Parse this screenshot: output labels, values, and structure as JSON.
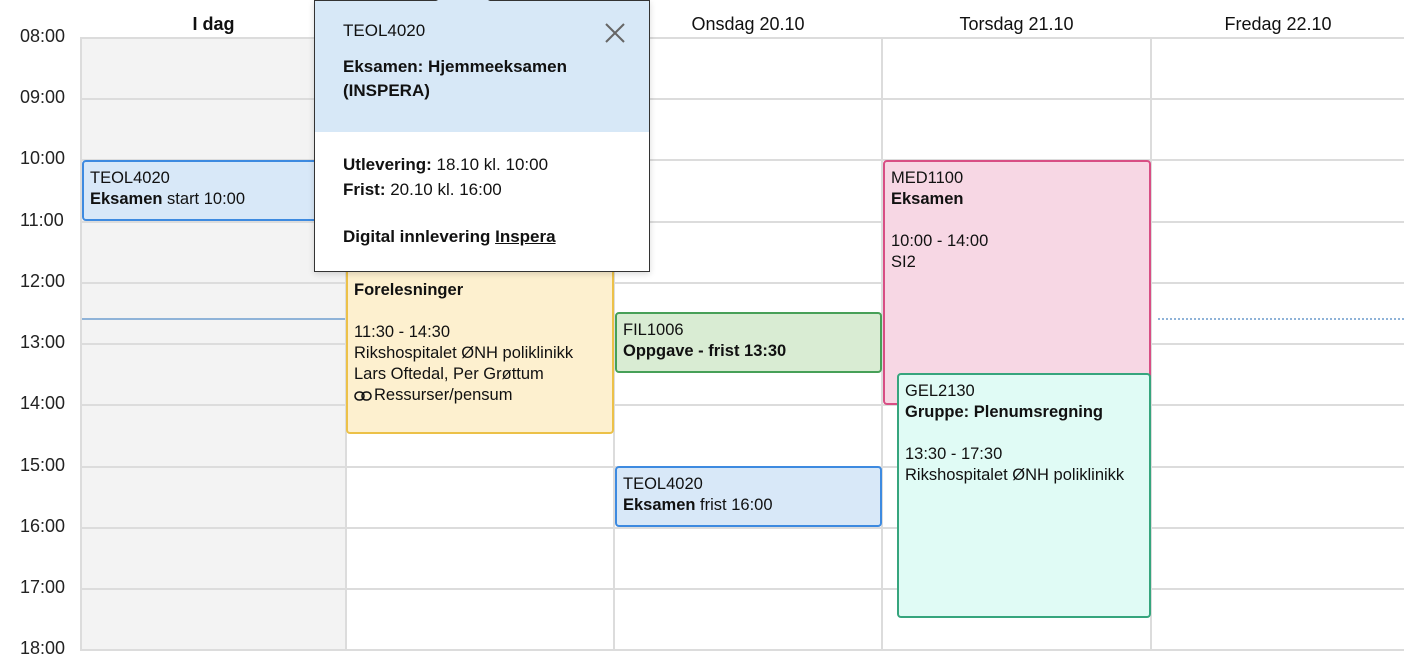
{
  "days": [
    "I dag",
    "",
    "Onsdag 20.10",
    "Torsdag 21.10",
    "Fredag 22.10"
  ],
  "hours": [
    "08:00",
    "09:00",
    "10:00",
    "11:00",
    "12:00",
    "13:00",
    "14:00",
    "15:00",
    "16:00",
    "17:00",
    "18:00"
  ],
  "colors": {
    "now_line": "#8fb3d8"
  },
  "events": {
    "teol_today": {
      "code": "TEOL4020",
      "title": "Eksamen",
      "rest": " start 10:00"
    },
    "lecture": {
      "title": "Forelesninger",
      "time": "11:30 - 14:30",
      "place": "Rikshospitalet ØNH poliklinikk",
      "people": "Lars Oftedal, Per Grøttum",
      "link_icon": "link-icon",
      "link": "Ressurser/pensum"
    },
    "fil": {
      "code": "FIL1006",
      "title": "Oppgave - frist 13:30"
    },
    "teol_wed": {
      "code": "TEOL4020",
      "title": "Eksamen",
      "rest": " frist 16:00"
    },
    "med": {
      "code": "MED1100",
      "title": "Eksamen",
      "time": "10:00 - 14:00",
      "place": "SI2"
    },
    "gel": {
      "code": "GEL2130",
      "title": "Gruppe: Plenumsregning",
      "time": "13:30 - 17:30",
      "place": "Rikshospitalet ØNH poliklinikk"
    }
  },
  "popover": {
    "code": "TEOL4020",
    "title": "Eksamen: Hjemmeeksamen (INSPERA)",
    "handout_label": "Utlevering:",
    "handout_value": " 18.10 kl. 10:00",
    "deadline_label": "Frist:",
    "deadline_value": " 20.10 kl. 16:00",
    "delivery_label": "Digital innlevering",
    "delivery_link": "Inspera",
    "close_icon": "close-icon"
  }
}
